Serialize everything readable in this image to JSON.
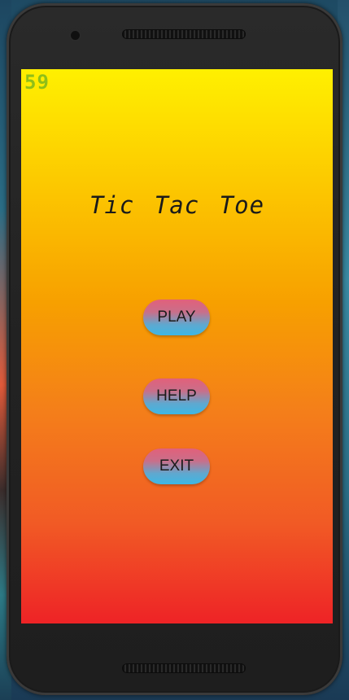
{
  "overlay": {
    "fps_counter": "59"
  },
  "app": {
    "title": "Tic Tac Toe"
  },
  "menu": {
    "play_label": "PLAY",
    "help_label": "HELP",
    "exit_label": "EXIT"
  },
  "colors": {
    "gradient_top": "#fff000",
    "gradient_bottom": "#ee2326",
    "button_top": "#e2607a",
    "button_bottom": "#3db7e4",
    "fps_color": "#8fbf18"
  }
}
